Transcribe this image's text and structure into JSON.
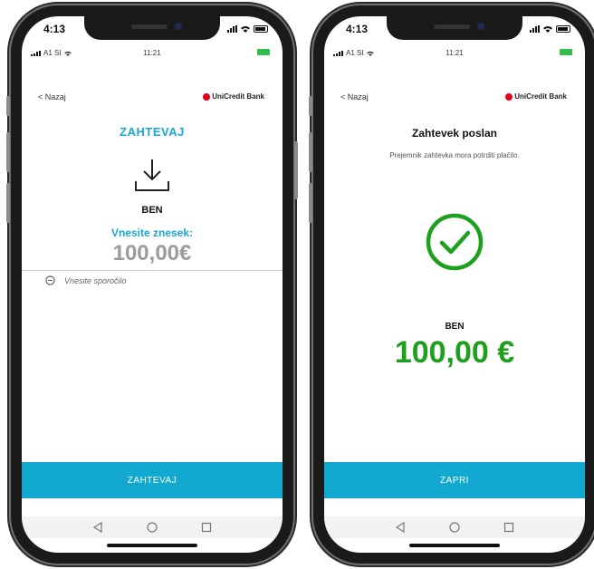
{
  "colors": {
    "accent": "#1aa6d4",
    "button": "#12a8cf",
    "success": "#1ea01e",
    "bank_red": "#e2001a"
  },
  "left_phone": {
    "status_time": "4:13",
    "inner_carrier": "A1 SI",
    "inner_time": "11:21",
    "back_label": "< Nazaj",
    "bank_name": "UniCredit Bank",
    "title": "ZAHTEVAJ",
    "icon": "download-icon",
    "recipient": "BEN",
    "amount_label": "Vnesite znesek:",
    "amount_value": "100,00€",
    "message_placeholder": "Vnesite sporočilo",
    "button_label": "ZAHTEVAJ"
  },
  "right_phone": {
    "status_time": "4:13",
    "inner_carrier": "A1 SI",
    "inner_time": "11:21",
    "back_label": "< Nazaj",
    "bank_name": "UniCredit Bank",
    "title": "Zahtevek poslan",
    "subtitle": "Prejemnik zahtevka mora potrditi plačilo.",
    "icon": "check-circle-icon",
    "recipient": "BEN",
    "amount": "100,00 €",
    "button_label": "ZAPRI"
  }
}
